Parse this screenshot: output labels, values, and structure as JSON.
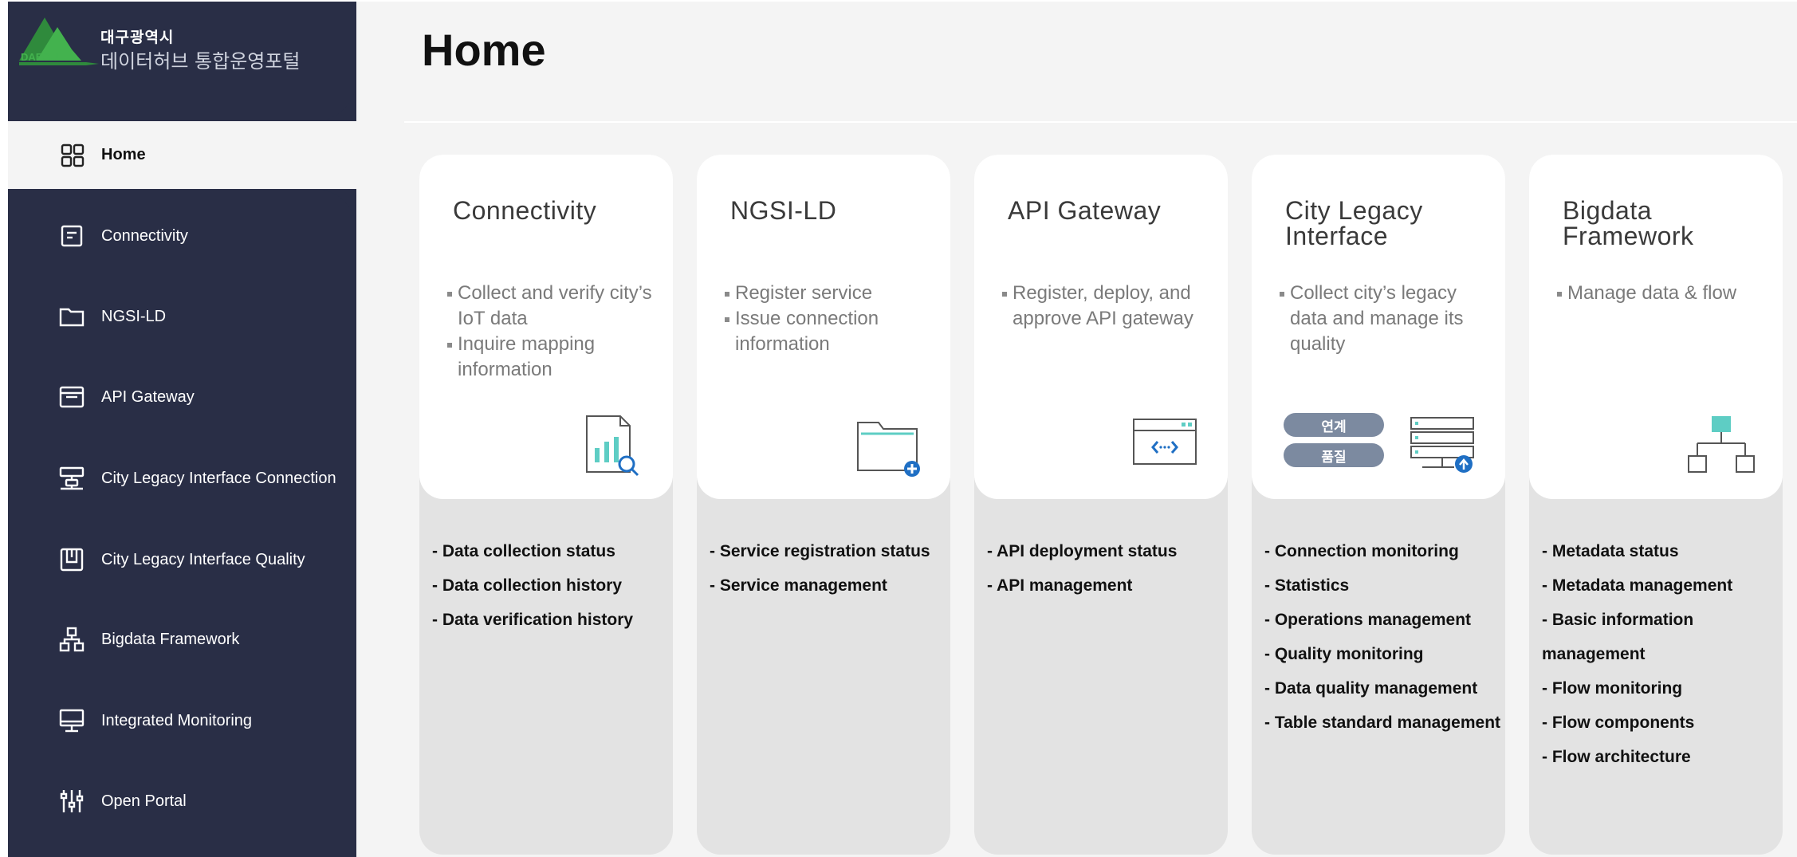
{
  "brand": {
    "logo_text": "DAEGU",
    "line1": "대구광역시",
    "line2": "데이터허브 통합운영포털",
    "colors": {
      "dark_green": "#2f8a3c",
      "light_green": "#43b24e",
      "sidebar_bg": "#292e46"
    }
  },
  "sidebar": {
    "items": [
      {
        "label": "Home",
        "icon": "grid-icon",
        "active": true
      },
      {
        "label": "Connectivity",
        "icon": "document-icon"
      },
      {
        "label": "NGSI-LD",
        "icon": "folder-icon"
      },
      {
        "label": "API Gateway",
        "icon": "browser-window-icon"
      },
      {
        "label": "City Legacy Interface Connection",
        "icon": "network-connection-icon"
      },
      {
        "label": "City Legacy Interface Quality",
        "icon": "quality-check-icon"
      },
      {
        "label": "Bigdata Framework",
        "icon": "hierarchy-icon"
      },
      {
        "label": "Integrated Monitoring",
        "icon": "monitor-icon"
      },
      {
        "label": "Open Portal",
        "icon": "sliders-icon"
      }
    ]
  },
  "main": {
    "title": "Home",
    "accent": "#5ecdc4",
    "icon_blue": "#1f6fc4",
    "cards": [
      {
        "title": "Connectivity",
        "bullets": [
          "Collect and verify city’s IoT data",
          "Inquire mapping information"
        ],
        "icon": "report-search-icon",
        "features": [
          "- Data collection status",
          "- Data collection history",
          "- Data verification history"
        ]
      },
      {
        "title": "NGSI-LD",
        "bullets": [
          "Register service",
          "Issue connection information"
        ],
        "icon": "folder-add-icon",
        "features": [
          "- Service registration status",
          "- Service management"
        ]
      },
      {
        "title": "API Gateway",
        "bullets": [
          "Register, deploy, and approve API gateway"
        ],
        "icon": "api-code-window-icon",
        "features": [
          "- API deployment status",
          "- API management"
        ]
      },
      {
        "title": "City Legacy Interface",
        "bullets": [
          "Collect city’s legacy data and manage its quality"
        ],
        "icon": "server-upload-icon",
        "pills": [
          "연계",
          "품질"
        ],
        "features": [
          "- Connection monitoring",
          "- Statistics",
          "- Operations management",
          "- Quality monitoring",
          "- Data quality management",
          "- Table standard management"
        ]
      },
      {
        "title": "Bigdata Framework",
        "bullets": [
          "Manage data & flow"
        ],
        "icon": "org-tree-icon",
        "features": [
          "- Metadata status",
          "- Metadata management",
          "- Basic information management",
          "- Flow monitoring",
          "- Flow components",
          "- Flow architecture"
        ]
      }
    ]
  }
}
